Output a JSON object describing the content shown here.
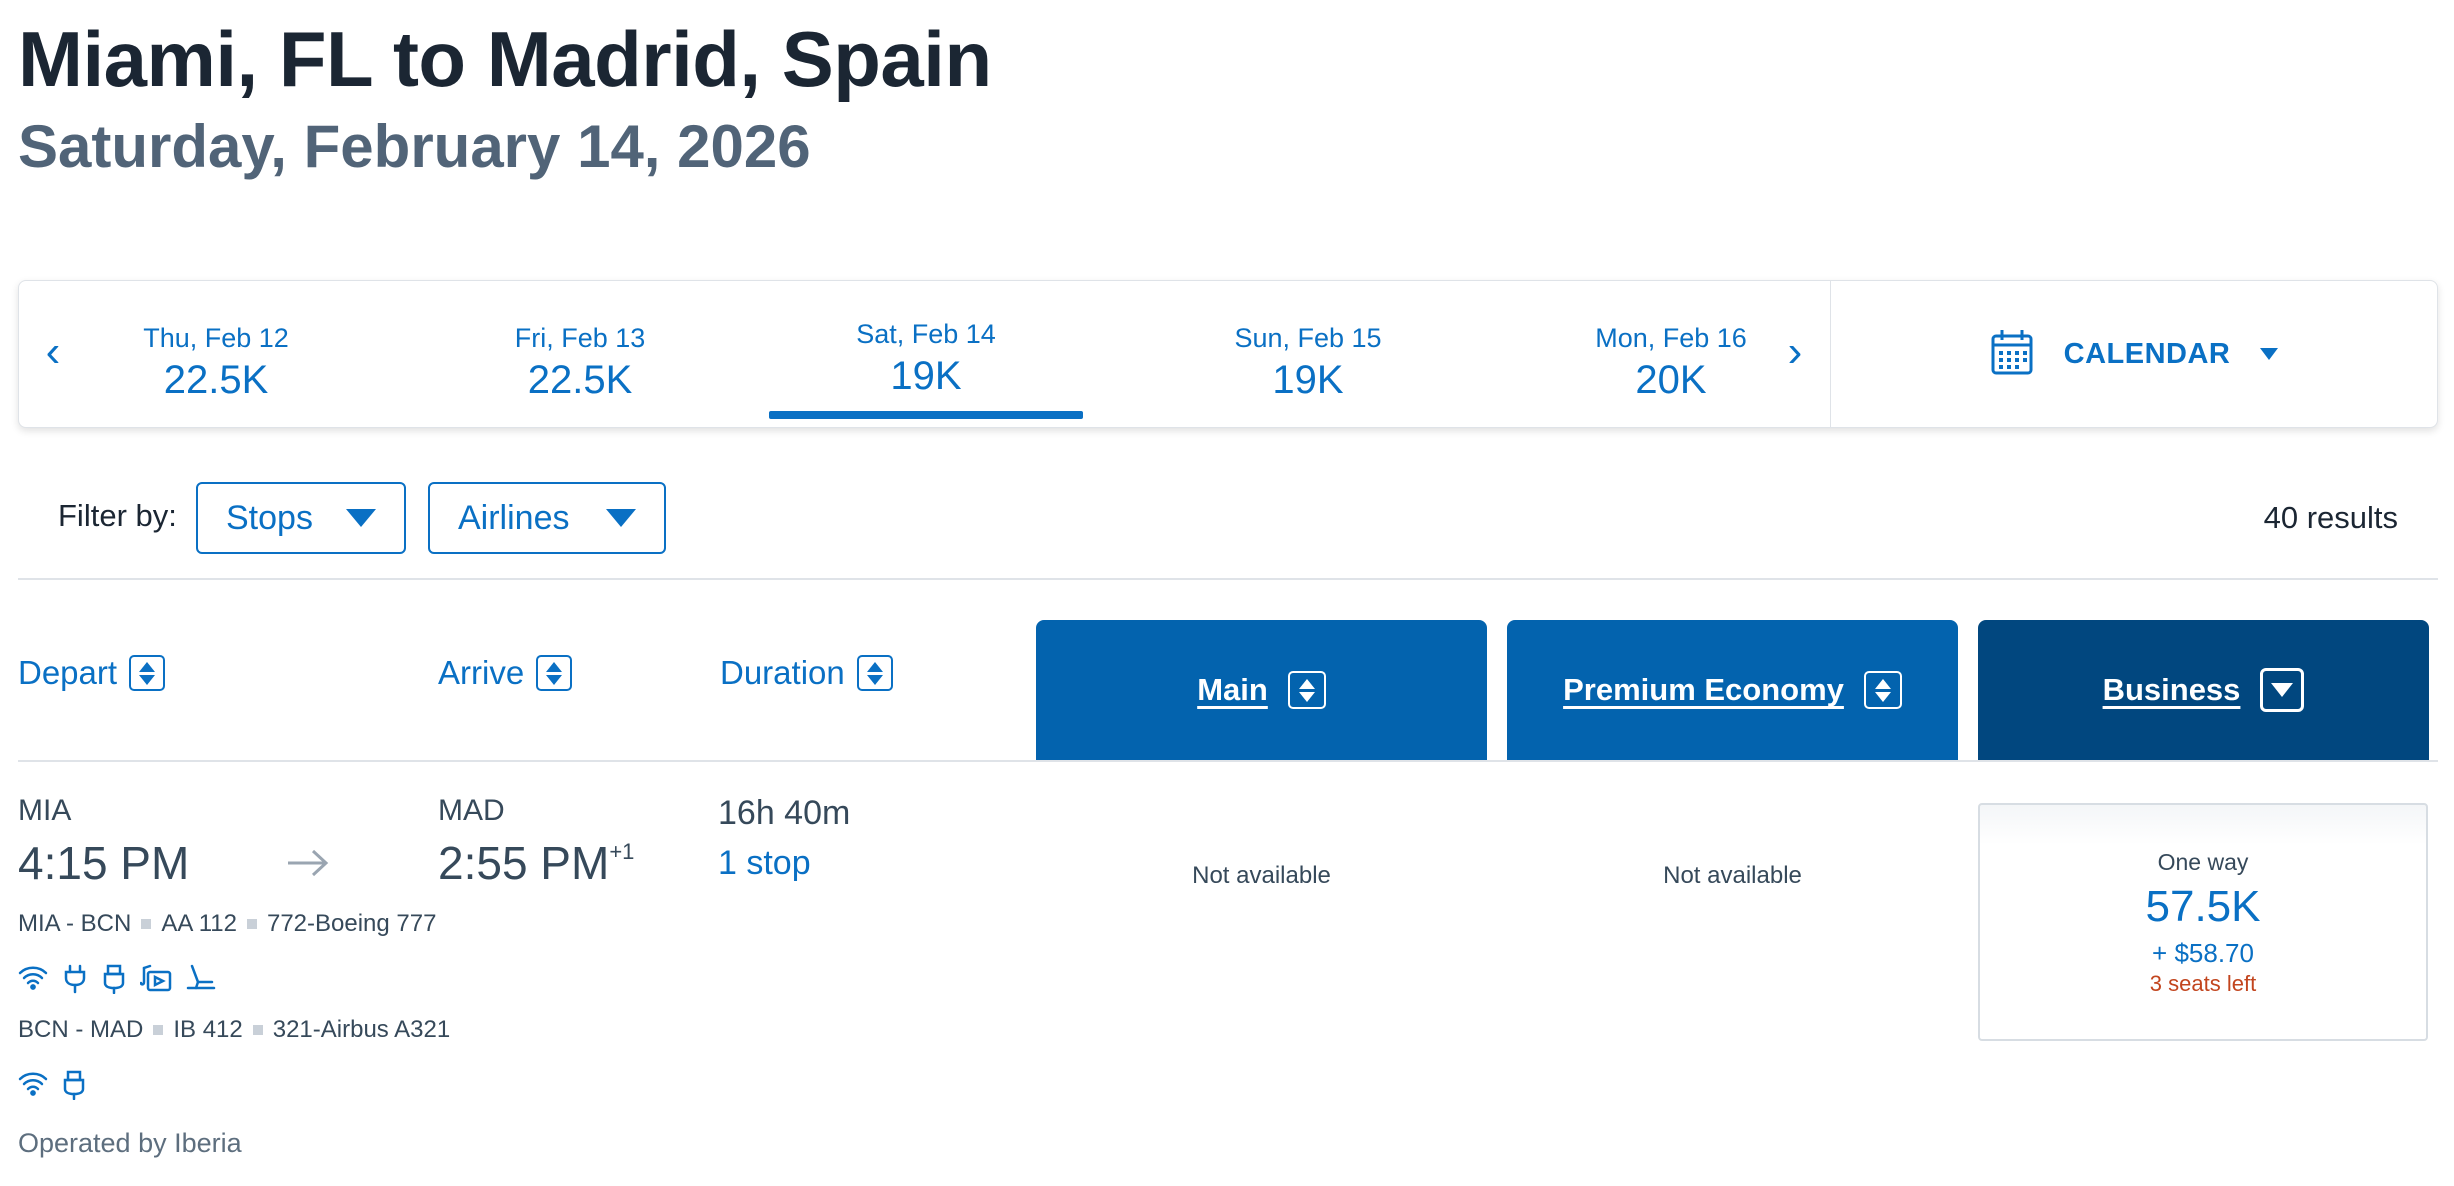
{
  "header": {
    "title": "Miami, FL to Madrid, Spain",
    "subtitle": "Saturday, February 14, 2026"
  },
  "date_bar": {
    "prev_icon": "chevron-left-icon",
    "next_icon": "chevron-right-icon",
    "dates": [
      {
        "label": "Thu, Feb 12",
        "value": "22.5K"
      },
      {
        "label": "Fri, Feb 13",
        "value": "22.5K"
      },
      {
        "label": "Sat, Feb 14",
        "value": "19K",
        "selected": true
      },
      {
        "label": "Sun, Feb 15",
        "value": "19K"
      },
      {
        "label": "Mon, Feb 16",
        "value": "20K"
      }
    ],
    "calendar_label": "CALENDAR",
    "calendar_icon": "calendar-icon"
  },
  "filters": {
    "label": "Filter by:",
    "stops": "Stops",
    "airlines": "Airlines",
    "results": "40 results"
  },
  "columns": {
    "depart": "Depart",
    "arrive": "Arrive",
    "duration": "Duration",
    "cabins": [
      "Main",
      "Premium Economy",
      "Business"
    ]
  },
  "flight": {
    "origin": "MIA",
    "depart_time": "4:15 PM",
    "destination": "MAD",
    "arrive_time": "2:55 PM",
    "arrive_day_offset": "+1",
    "duration": "16h 40m",
    "stops": "1 stop",
    "segments": [
      {
        "route": "MIA - BCN",
        "flight": "AA 112",
        "aircraft": "772-Boeing 777",
        "amenities": [
          "wifi-icon",
          "power-outlet-icon",
          "usb-icon",
          "entertainment-icon",
          "lie-flat-seat-icon"
        ]
      },
      {
        "route": "BCN - MAD",
        "flight": "IB 412",
        "aircraft": "321-Airbus A321",
        "amenities": [
          "wifi-icon",
          "usb-icon"
        ]
      }
    ],
    "operated_by": "Operated by Iberia",
    "main": "Not available",
    "premium_economy": "Not available",
    "business": {
      "type": "One way",
      "miles": "57.5K",
      "taxes": "+ $58.70",
      "seats": "3 seats left"
    }
  },
  "colors": {
    "brand_blue": "#0a70c4",
    "cabin_main": "#0363ae",
    "cabin_premium": "#0363ae",
    "cabin_business": "#01477f",
    "seats_warning": "#c2451e"
  }
}
